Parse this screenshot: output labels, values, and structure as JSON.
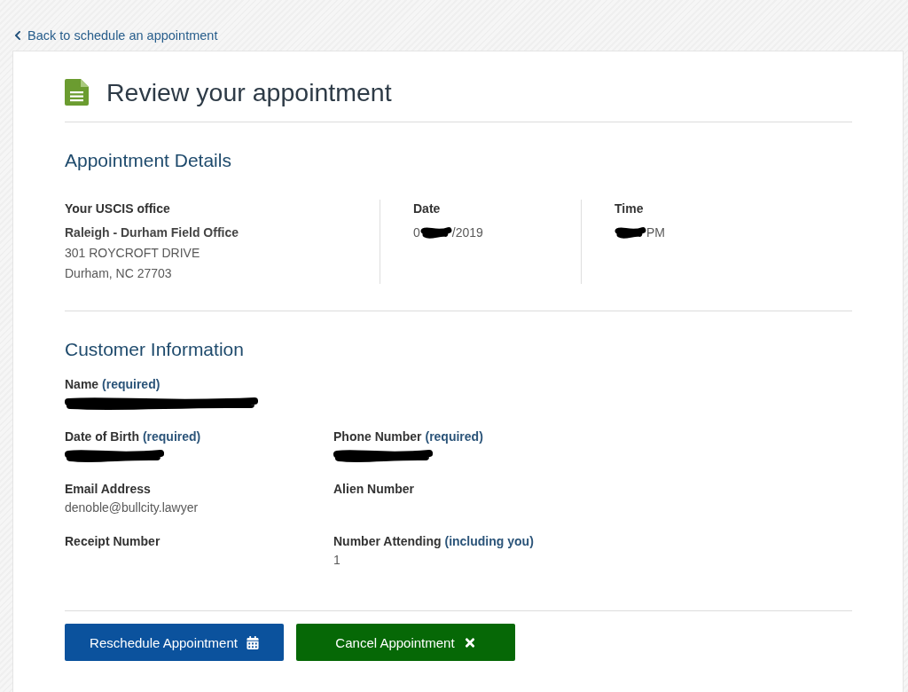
{
  "back_link": {
    "label": "Back to schedule an appointment"
  },
  "title": "Review your appointment",
  "appointment_details": {
    "heading": "Appointment Details",
    "columns": [
      {
        "label": "Your USCIS office",
        "lines": [
          {
            "kind": "strong",
            "parts": [
              {
                "kind": "text",
                "text": "Raleigh - Durham Field Office"
              }
            ]
          },
          {
            "kind": "plain",
            "parts": [
              {
                "kind": "text",
                "text": "301 ROYCROFT DRIVE"
              }
            ]
          },
          {
            "kind": "plain",
            "parts": [
              {
                "kind": "text",
                "text": "Durham, NC 27703"
              }
            ]
          }
        ]
      },
      {
        "label": "Date",
        "lines": [
          {
            "kind": "plain",
            "parts": [
              {
                "kind": "text",
                "text": "0"
              },
              {
                "kind": "redaction"
              },
              {
                "kind": "text",
                "text": "/2019"
              }
            ]
          }
        ]
      },
      {
        "label": "Time",
        "lines": [
          {
            "kind": "plain",
            "parts": [
              {
                "kind": "redaction"
              },
              {
                "kind": "text",
                "text": "PM"
              }
            ]
          }
        ]
      }
    ]
  },
  "customer_information": {
    "heading": "Customer Information",
    "rows": [
      [
        {
          "label": "Name",
          "note": "(required)",
          "value": [
            {
              "kind": "redaction"
            }
          ]
        }
      ],
      [
        {
          "label": "Date of Birth",
          "note": "(required)",
          "value": [
            {
              "kind": "redaction"
            }
          ]
        },
        {
          "label": "Phone Number",
          "note": "(required)",
          "value": [
            {
              "kind": "redaction"
            }
          ]
        }
      ],
      [
        {
          "label": "Email Address",
          "value": [
            {
              "kind": "text",
              "text": "denoble@bullcity.lawyer"
            }
          ]
        },
        {
          "label": "Alien Number"
        }
      ],
      [
        {
          "label": "Receipt Number"
        },
        {
          "label": "Number Attending",
          "note": "(including you)",
          "value": [
            {
              "kind": "text",
              "text": "1"
            }
          ]
        }
      ]
    ]
  },
  "buttons": [
    {
      "label": "Reschedule Appointment",
      "kind": "reschedule"
    },
    {
      "label": "Cancel Appointment",
      "kind": "cancel"
    }
  ]
}
